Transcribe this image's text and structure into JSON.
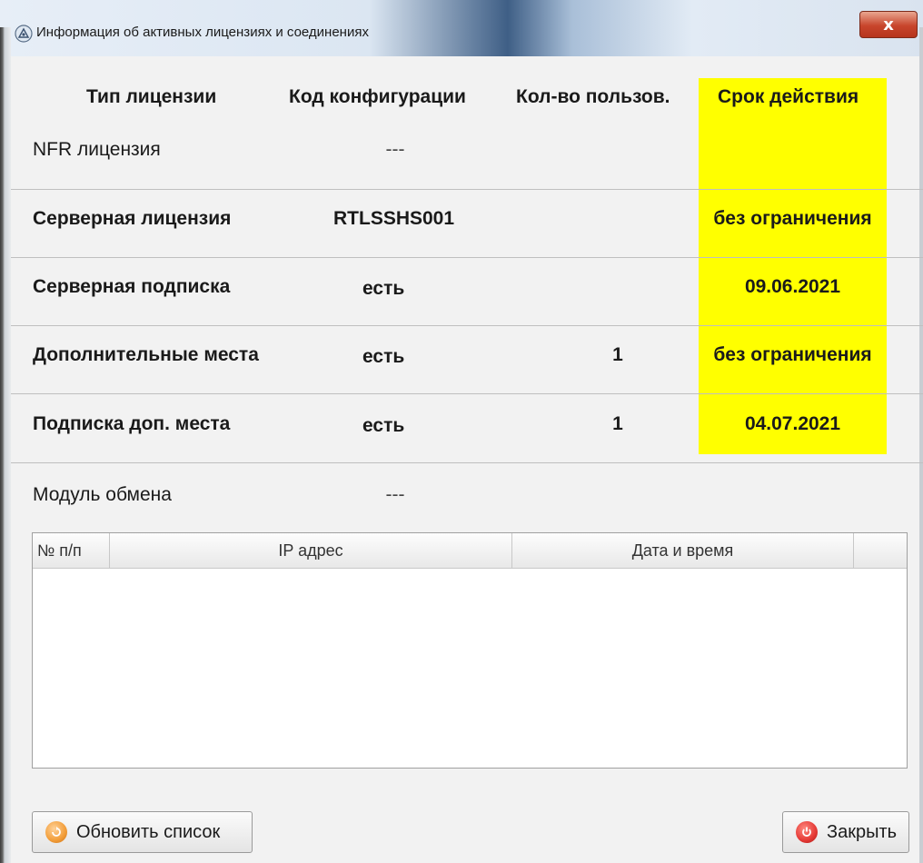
{
  "window": {
    "title": "Информация об активных лицензиях и соединениях",
    "close_label": "x"
  },
  "colors": {
    "highlight": "#ffff00",
    "close_button": "#c8452c",
    "refresh_icon": "#f29d38",
    "close_icon": "#e53935"
  },
  "table": {
    "headers": {
      "license_type": "Тип лицензии",
      "config_code": "Код конфигурации",
      "user_count": "Кол-во пользов.",
      "validity": "Срок действия"
    },
    "rows": [
      {
        "type": "NFR лицензия",
        "code": "---",
        "users": "",
        "validity": "",
        "bold": false
      },
      {
        "type": "Серверная лицензия",
        "code": "RTLSSHS001",
        "users": "",
        "validity": "без ограничения",
        "bold": true
      },
      {
        "type": "Серверная подписка",
        "code": "есть",
        "users": "",
        "validity": "09.06.2021",
        "bold": true
      },
      {
        "type": "Дополнительные места",
        "code": "есть",
        "users": "1",
        "validity": "без ограничения",
        "bold": true
      },
      {
        "type": "Подписка доп. места",
        "code": "есть",
        "users": "1",
        "validity": "04.07.2021",
        "bold": true
      }
    ],
    "exchange_module": {
      "label": "Модуль обмена",
      "value": "---"
    }
  },
  "connections": {
    "columns": [
      "№ п/п",
      "IP адрес",
      "Дата и время",
      ""
    ],
    "rows": []
  },
  "buttons": {
    "refresh": {
      "label": "Обновить список",
      "icon": "refresh-icon"
    },
    "close": {
      "label": "Закрыть",
      "icon": "power-icon"
    }
  }
}
